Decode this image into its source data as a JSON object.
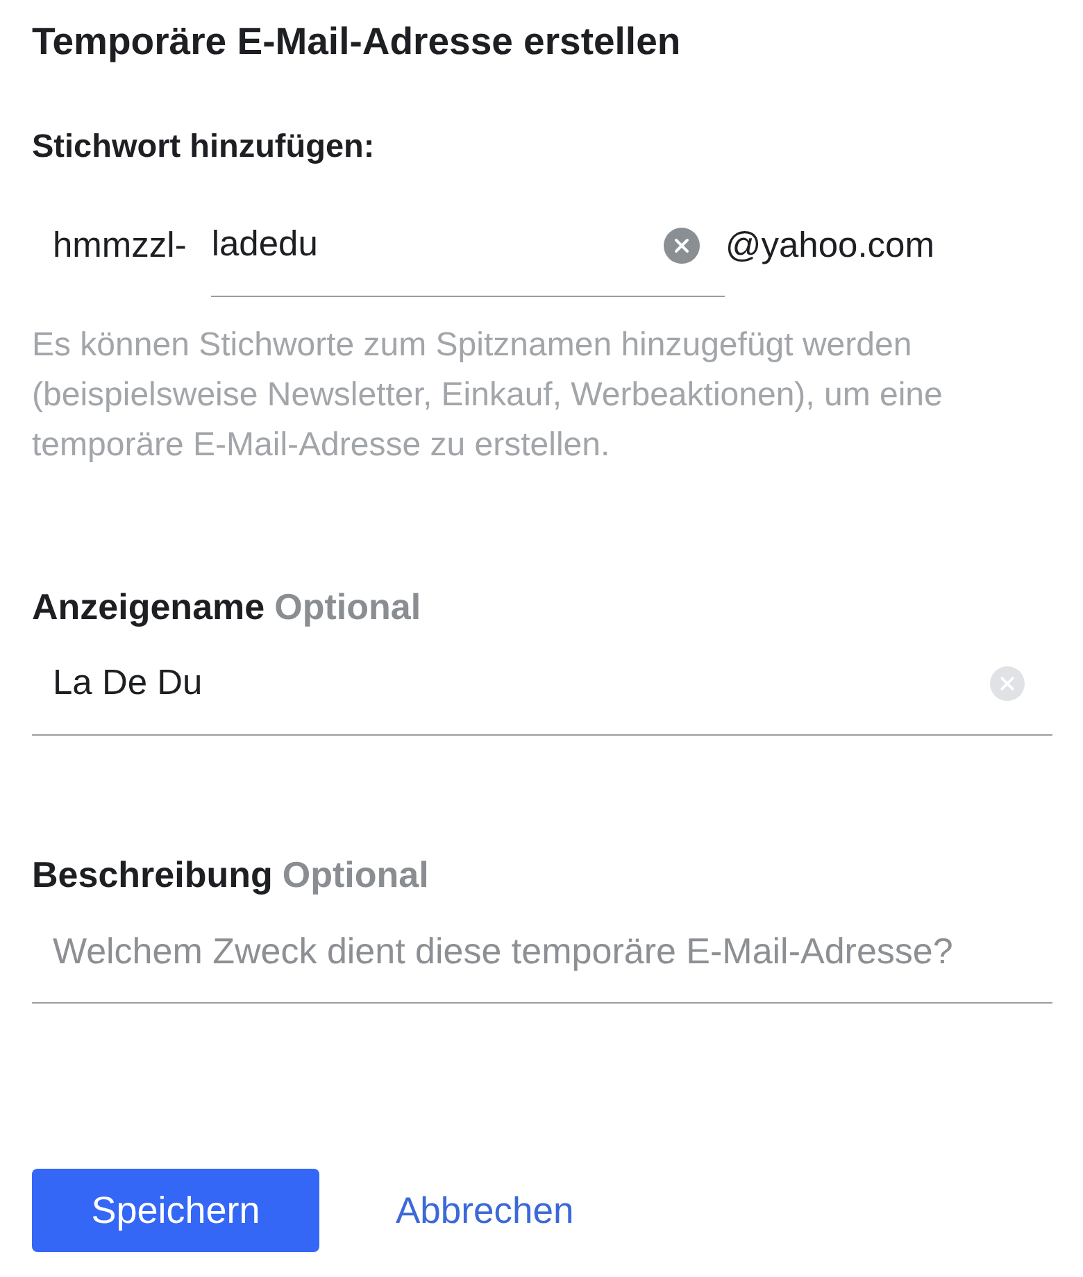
{
  "title": "Temporäre E-Mail-Adresse erstellen",
  "keyword_section": {
    "label": "Stichwort hinzufügen:",
    "prefix": "hmmzzl-",
    "field": {
      "value": "ladedu",
      "focused": true
    },
    "suffix": "@yahoo.com",
    "help_text": "Es können Stichworte zum Spitznamen hinzugefügt werden (beispielsweise Newsletter, Einkauf, Werbeaktionen), um eine temporäre E-Mail-Adresse zu erstellen."
  },
  "fields": [
    {
      "label": "Anzeigename",
      "optional_tag": "Optional",
      "value": "La De Du",
      "focused": false
    },
    {
      "label": "Beschreibung",
      "optional_tag": "Optional",
      "placeholder": "Welchem Zweck dient diese temporäre E-Mail-Adresse?"
    }
  ],
  "buttons": [
    {
      "kind": "primary",
      "label": "Speichern"
    },
    {
      "kind": "link",
      "label": "Abbrechen"
    }
  ]
}
